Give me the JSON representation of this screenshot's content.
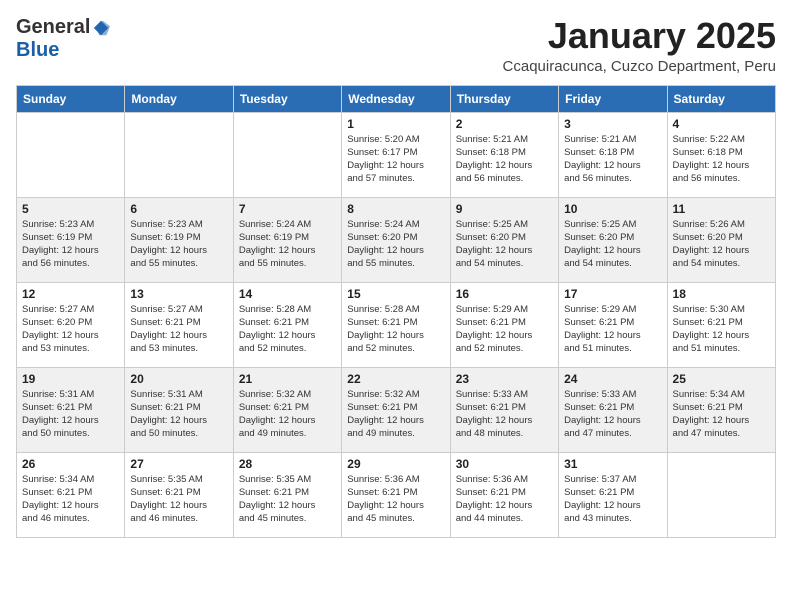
{
  "logo": {
    "general": "General",
    "blue": "Blue"
  },
  "title": "January 2025",
  "subtitle": "Ccaquiracunca, Cuzco Department, Peru",
  "weekdays": [
    "Sunday",
    "Monday",
    "Tuesday",
    "Wednesday",
    "Thursday",
    "Friday",
    "Saturday"
  ],
  "weeks": [
    [
      {
        "day": "",
        "info": ""
      },
      {
        "day": "",
        "info": ""
      },
      {
        "day": "",
        "info": ""
      },
      {
        "day": "1",
        "info": "Sunrise: 5:20 AM\nSunset: 6:17 PM\nDaylight: 12 hours\nand 57 minutes."
      },
      {
        "day": "2",
        "info": "Sunrise: 5:21 AM\nSunset: 6:18 PM\nDaylight: 12 hours\nand 56 minutes."
      },
      {
        "day": "3",
        "info": "Sunrise: 5:21 AM\nSunset: 6:18 PM\nDaylight: 12 hours\nand 56 minutes."
      },
      {
        "day": "4",
        "info": "Sunrise: 5:22 AM\nSunset: 6:18 PM\nDaylight: 12 hours\nand 56 minutes."
      }
    ],
    [
      {
        "day": "5",
        "info": "Sunrise: 5:23 AM\nSunset: 6:19 PM\nDaylight: 12 hours\nand 56 minutes."
      },
      {
        "day": "6",
        "info": "Sunrise: 5:23 AM\nSunset: 6:19 PM\nDaylight: 12 hours\nand 55 minutes."
      },
      {
        "day": "7",
        "info": "Sunrise: 5:24 AM\nSunset: 6:19 PM\nDaylight: 12 hours\nand 55 minutes."
      },
      {
        "day": "8",
        "info": "Sunrise: 5:24 AM\nSunset: 6:20 PM\nDaylight: 12 hours\nand 55 minutes."
      },
      {
        "day": "9",
        "info": "Sunrise: 5:25 AM\nSunset: 6:20 PM\nDaylight: 12 hours\nand 54 minutes."
      },
      {
        "day": "10",
        "info": "Sunrise: 5:25 AM\nSunset: 6:20 PM\nDaylight: 12 hours\nand 54 minutes."
      },
      {
        "day": "11",
        "info": "Sunrise: 5:26 AM\nSunset: 6:20 PM\nDaylight: 12 hours\nand 54 minutes."
      }
    ],
    [
      {
        "day": "12",
        "info": "Sunrise: 5:27 AM\nSunset: 6:20 PM\nDaylight: 12 hours\nand 53 minutes."
      },
      {
        "day": "13",
        "info": "Sunrise: 5:27 AM\nSunset: 6:21 PM\nDaylight: 12 hours\nand 53 minutes."
      },
      {
        "day": "14",
        "info": "Sunrise: 5:28 AM\nSunset: 6:21 PM\nDaylight: 12 hours\nand 52 minutes."
      },
      {
        "day": "15",
        "info": "Sunrise: 5:28 AM\nSunset: 6:21 PM\nDaylight: 12 hours\nand 52 minutes."
      },
      {
        "day": "16",
        "info": "Sunrise: 5:29 AM\nSunset: 6:21 PM\nDaylight: 12 hours\nand 52 minutes."
      },
      {
        "day": "17",
        "info": "Sunrise: 5:29 AM\nSunset: 6:21 PM\nDaylight: 12 hours\nand 51 minutes."
      },
      {
        "day": "18",
        "info": "Sunrise: 5:30 AM\nSunset: 6:21 PM\nDaylight: 12 hours\nand 51 minutes."
      }
    ],
    [
      {
        "day": "19",
        "info": "Sunrise: 5:31 AM\nSunset: 6:21 PM\nDaylight: 12 hours\nand 50 minutes."
      },
      {
        "day": "20",
        "info": "Sunrise: 5:31 AM\nSunset: 6:21 PM\nDaylight: 12 hours\nand 50 minutes."
      },
      {
        "day": "21",
        "info": "Sunrise: 5:32 AM\nSunset: 6:21 PM\nDaylight: 12 hours\nand 49 minutes."
      },
      {
        "day": "22",
        "info": "Sunrise: 5:32 AM\nSunset: 6:21 PM\nDaylight: 12 hours\nand 49 minutes."
      },
      {
        "day": "23",
        "info": "Sunrise: 5:33 AM\nSunset: 6:21 PM\nDaylight: 12 hours\nand 48 minutes."
      },
      {
        "day": "24",
        "info": "Sunrise: 5:33 AM\nSunset: 6:21 PM\nDaylight: 12 hours\nand 47 minutes."
      },
      {
        "day": "25",
        "info": "Sunrise: 5:34 AM\nSunset: 6:21 PM\nDaylight: 12 hours\nand 47 minutes."
      }
    ],
    [
      {
        "day": "26",
        "info": "Sunrise: 5:34 AM\nSunset: 6:21 PM\nDaylight: 12 hours\nand 46 minutes."
      },
      {
        "day": "27",
        "info": "Sunrise: 5:35 AM\nSunset: 6:21 PM\nDaylight: 12 hours\nand 46 minutes."
      },
      {
        "day": "28",
        "info": "Sunrise: 5:35 AM\nSunset: 6:21 PM\nDaylight: 12 hours\nand 45 minutes."
      },
      {
        "day": "29",
        "info": "Sunrise: 5:36 AM\nSunset: 6:21 PM\nDaylight: 12 hours\nand 45 minutes."
      },
      {
        "day": "30",
        "info": "Sunrise: 5:36 AM\nSunset: 6:21 PM\nDaylight: 12 hours\nand 44 minutes."
      },
      {
        "day": "31",
        "info": "Sunrise: 5:37 AM\nSunset: 6:21 PM\nDaylight: 12 hours\nand 43 minutes."
      },
      {
        "day": "",
        "info": ""
      }
    ]
  ]
}
